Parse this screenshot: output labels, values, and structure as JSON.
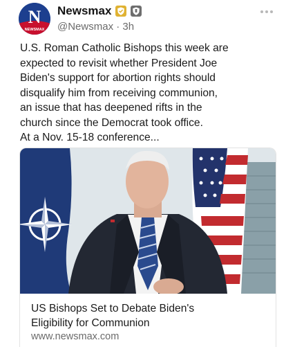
{
  "account": {
    "display_name": "Newsmax",
    "handle": "@Newsmax",
    "separator": " · ",
    "time_ago": "3h",
    "avatar_letter": "N",
    "avatar_caption": "NEWSMAX",
    "badges": [
      "gold-verified-icon",
      "official-shield-icon"
    ],
    "colors": {
      "avatar": "#1d3f8f",
      "gold_badge": "#e0b232",
      "gray_badge": "#6e6e6e"
    }
  },
  "post": {
    "text_lines": [
      "U.S. Roman Catholic Bishops this week are",
      "expected to revisit whether President Joe",
      "Biden's support for abortion rights should",
      "disqualify him from receiving communion,",
      "an issue that has deepened rifts in the",
      "church since the Democrat took office.",
      "At a Nov. 15-18 conference..."
    ]
  },
  "link_card": {
    "title_lines": [
      "US Bishops Set to Debate Biden's",
      "Eligibility for Communion"
    ],
    "domain": "www.newsmax.com",
    "image_icon": "news-photo-icon"
  },
  "menu": {
    "icon": "more-options-icon"
  }
}
